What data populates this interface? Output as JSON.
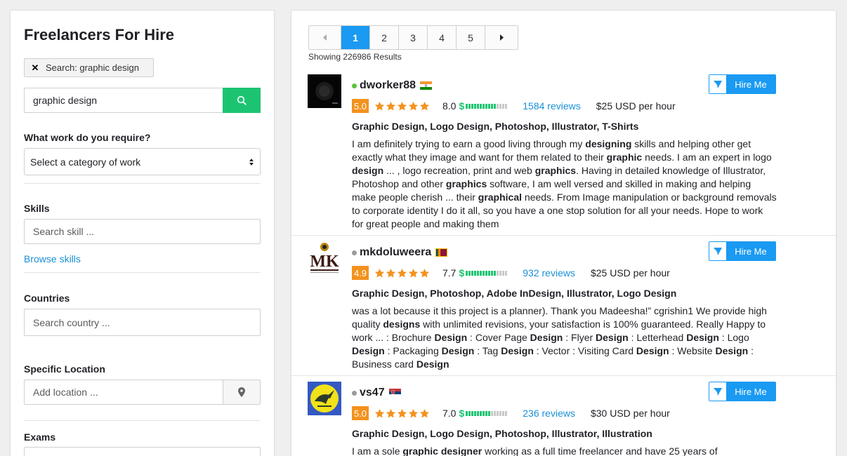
{
  "sidebar": {
    "title": "Freelancers For Hire",
    "chip_label": "Search: graphic design",
    "search_value": "graphic design",
    "work_label": "What work do you require?",
    "work_select": "Select a category of work",
    "skills_label": "Skills",
    "skills_placeholder": "Search skill ...",
    "browse_skills": "Browse skills",
    "countries_label": "Countries",
    "countries_placeholder": "Search country ...",
    "location_label": "Specific Location",
    "location_placeholder": "Add location ...",
    "exams_label": "Exams"
  },
  "pagination": {
    "pages": [
      "1",
      "2",
      "3",
      "4",
      "5"
    ],
    "active": "1",
    "showing": "Showing 226986 Results"
  },
  "hire_label": "Hire Me",
  "freelancers": [
    {
      "username": "dworker88",
      "online": true,
      "flag": "india-flag",
      "rating": "5.0",
      "stars": 5,
      "score": "8.0",
      "earnings_level": 0.75,
      "reviews": "1584 reviews",
      "rate": "$25 USD per hour",
      "skills": "Graphic Design, Logo Design, Photoshop, Illustrator, T-Shirts",
      "description": "I am definitely trying to earn a good living through my <b>designing</b> skills and helping other get exactly what they image and want for them related to their <b>graphic</b> needs. I am an expert in logo <b>design</b> ... , logo recreation, print and web <b>graphics</b>. Having in detailed knowledge of Illustrator, Photoshop and other <b>graphics</b> software, I am well versed and skilled in making and helping make people cherish ... their <b>graphical</b> needs. From Image manipulation or background removals to corporate identity I do it all, so you have a one stop solution for all your needs. Hope to work for great people and making them"
    },
    {
      "username": "mkdoluweera",
      "online": false,
      "flag": "sri-lanka-flag",
      "rating": "4.9",
      "stars": 5,
      "score": "7.7",
      "earnings_level": 0.7,
      "reviews": "932 reviews",
      "rate": "$25 USD per hour",
      "skills": "Graphic Design, Photoshop, Adobe InDesign, Illustrator, Logo Design",
      "description": "was a lot because it this project is a planner). Thank you Madeesha!” cgrishin1 We provide high quality <b>designs</b> with unlimited revisions, your satisfaction is 100% guaranteed. Really Happy to work ... : Brochure <b>Design</b> : Cover Page <b>Design</b> : Flyer <b>Design</b> : Letterhead <b>Design</b> : Logo <b>Design</b> : Packaging <b>Design</b> : Tag <b>Design</b> : Vector : Visiting Card <b>Design</b> : Website <b>Design</b> : Business card <b>Design</b>"
    },
    {
      "username": "vs47",
      "online": false,
      "flag": "serbia-flag",
      "rating": "5.0",
      "stars": 5,
      "score": "7.0",
      "earnings_level": 0.62,
      "reviews": "236 reviews",
      "rate": "$30 USD per hour",
      "skills": "Graphic Design, Logo Design, Photoshop, Illustrator, Illustration",
      "description": "I am a sole <b>graphic designer</b> working as a full time freelancer and have 25 years of"
    }
  ],
  "colors": {
    "accent_blue": "#1a9af2",
    "search_green": "#1cc472",
    "rating_orange": "#f3921e",
    "online_green": "#5ac43b"
  }
}
